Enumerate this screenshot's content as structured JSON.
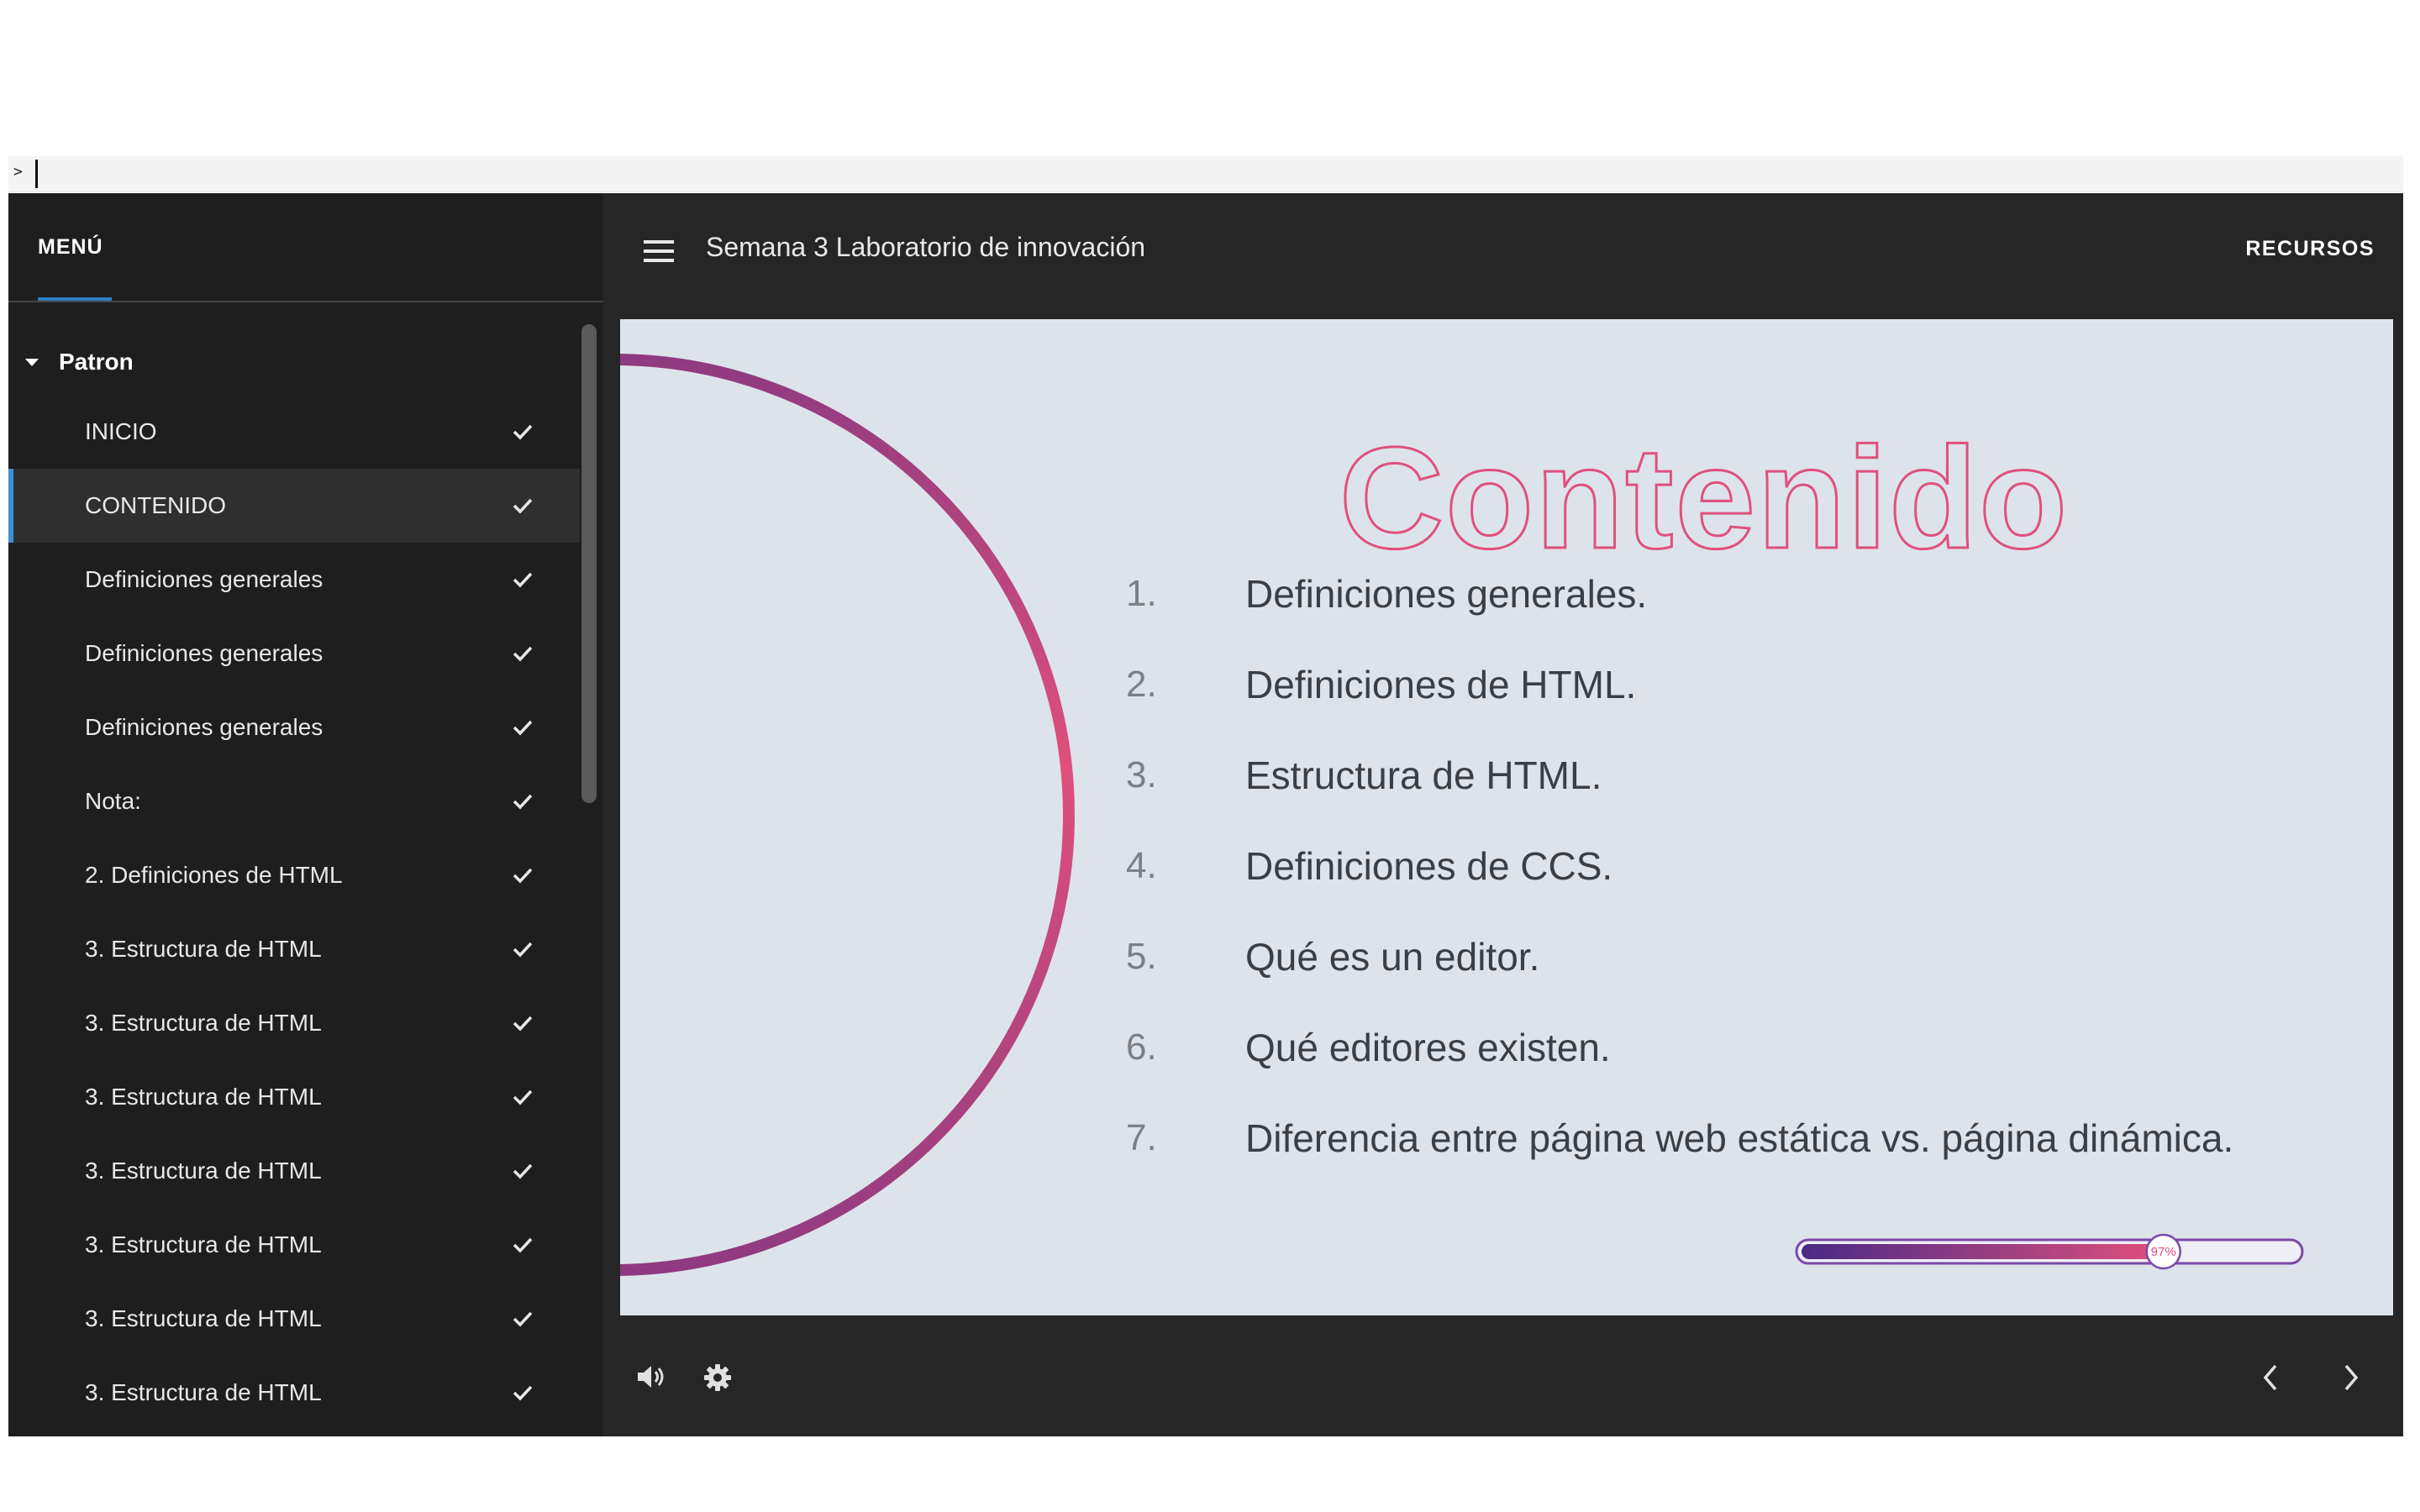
{
  "console": {
    "prompt": ">"
  },
  "sidebar": {
    "menu_label": "MENÚ",
    "section_label": "Patron",
    "items": [
      {
        "label": "INICIO",
        "done": true,
        "active": false
      },
      {
        "label": "CONTENIDO",
        "done": true,
        "active": true
      },
      {
        "label": "Definiciones generales",
        "done": true,
        "active": false
      },
      {
        "label": "Definiciones generales",
        "done": true,
        "active": false
      },
      {
        "label": "Definiciones generales",
        "done": true,
        "active": false
      },
      {
        "label": "Nota:",
        "done": true,
        "active": false
      },
      {
        "label": "2. Definiciones de HTML",
        "done": true,
        "active": false
      },
      {
        "label": "3. Estructura de HTML",
        "done": true,
        "active": false
      },
      {
        "label": "3. Estructura de HTML",
        "done": true,
        "active": false
      },
      {
        "label": "3. Estructura de HTML",
        "done": true,
        "active": false
      },
      {
        "label": "3. Estructura de HTML",
        "done": true,
        "active": false
      },
      {
        "label": "3. Estructura de HTML",
        "done": true,
        "active": false
      },
      {
        "label": "3. Estructura de HTML",
        "done": true,
        "active": false
      },
      {
        "label": "3. Estructura de HTML",
        "done": true,
        "active": false
      }
    ]
  },
  "header": {
    "course_title": "Semana 3 Laboratorio de innovación",
    "resources_label": "RECURSOS"
  },
  "slide": {
    "title": "Contenido",
    "list": [
      {
        "num": "1.",
        "text": "Definiciones generales."
      },
      {
        "num": "2.",
        "text": "Definiciones de HTML."
      },
      {
        "num": "3.",
        "text": "Estructura de HTML."
      },
      {
        "num": "4.",
        "text": "Definiciones de CCS."
      },
      {
        "num": "5.",
        "text": "Qué es un editor."
      },
      {
        "num": "6.",
        "text": "Qué editores existen."
      },
      {
        "num": "7.",
        "text": "Diferencia entre página web estática vs. página dinámica."
      }
    ],
    "progress": {
      "value": 0.97,
      "label": "97%"
    }
  },
  "colors": {
    "accent_pink": "#e0507c",
    "accent_purple": "#4a2a85",
    "active_bar": "#3d8fd6"
  },
  "icons": {
    "audio": "speaker-icon",
    "settings": "gear-icon",
    "prev": "chevron-left-icon",
    "next": "chevron-right-icon"
  }
}
